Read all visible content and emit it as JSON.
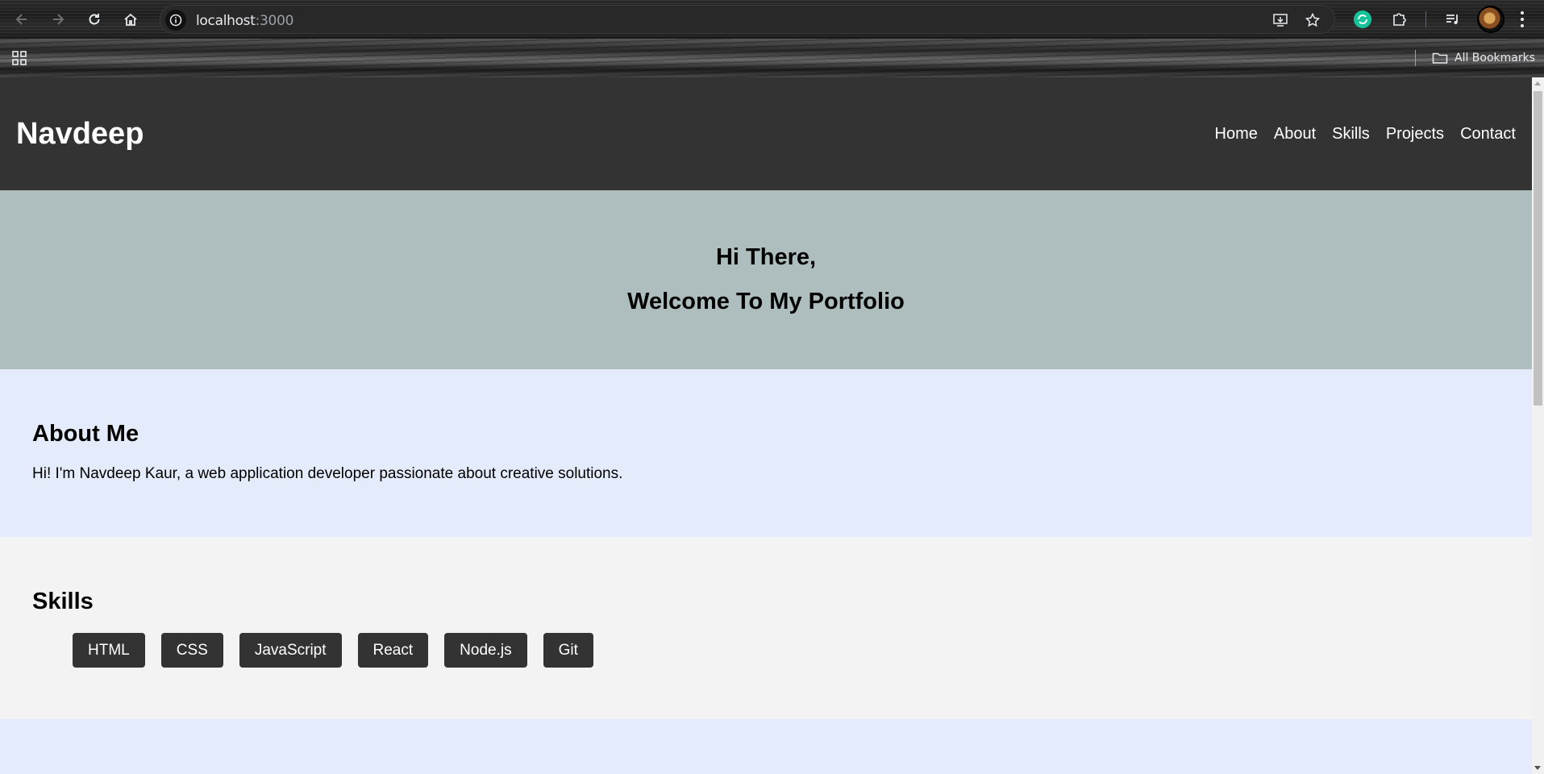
{
  "browser": {
    "url_host": "localhost",
    "url_port": ":3000",
    "bookmarks_label": "All Bookmarks"
  },
  "header": {
    "brand": "Navdeep",
    "nav": [
      {
        "label": "Home"
      },
      {
        "label": "About"
      },
      {
        "label": "Skills"
      },
      {
        "label": "Projects"
      },
      {
        "label": "Contact"
      }
    ]
  },
  "hero": {
    "greeting": "Hi There,",
    "welcome": "Welcome To My Portfolio"
  },
  "about": {
    "title": "About Me",
    "text": "Hi! I'm Navdeep Kaur, a web application developer passionate about creative solutions."
  },
  "skills": {
    "title": "Skills",
    "items": [
      {
        "label": "HTML"
      },
      {
        "label": "CSS"
      },
      {
        "label": "JavaScript"
      },
      {
        "label": "React"
      },
      {
        "label": "Node.js"
      },
      {
        "label": "Git"
      }
    ]
  },
  "colors": {
    "header_bg": "#333333",
    "hero_bg": "#aebebe",
    "about_bg": "#e4ebfa",
    "skills_bg": "#f3f3f3",
    "skill_chip_bg": "#333333"
  }
}
